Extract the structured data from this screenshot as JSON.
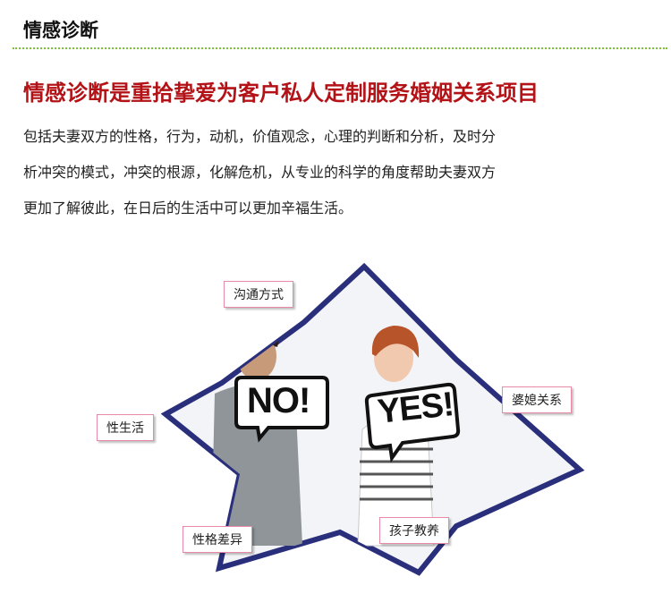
{
  "header": {
    "title": "情感诊断"
  },
  "article": {
    "headline": "情感诊断是重拾挚爱为客户私人定制服务婚姻关系项目",
    "paragraph_lines": [
      "包括夫妻双方的性格，行为，动机，价值观念，心理的判断和分析，及时分",
      "析冲突的模式，冲突的根源，化解危机，从专业的科学的角度帮助夫妻双方",
      "更加了解彼此，在日后的生活中可以更加辛福生活。"
    ]
  },
  "diagram": {
    "labels": {
      "communication": "沟通方式",
      "in_laws": "婆媳关系",
      "sex_life": "性生活",
      "personality": "性格差异",
      "parenting": "孩子教养"
    },
    "signs": {
      "no": "NO!",
      "yes": "YES!"
    },
    "colors": {
      "star_outline": "#2a2f7c",
      "label_border": "#e88aa5"
    }
  }
}
